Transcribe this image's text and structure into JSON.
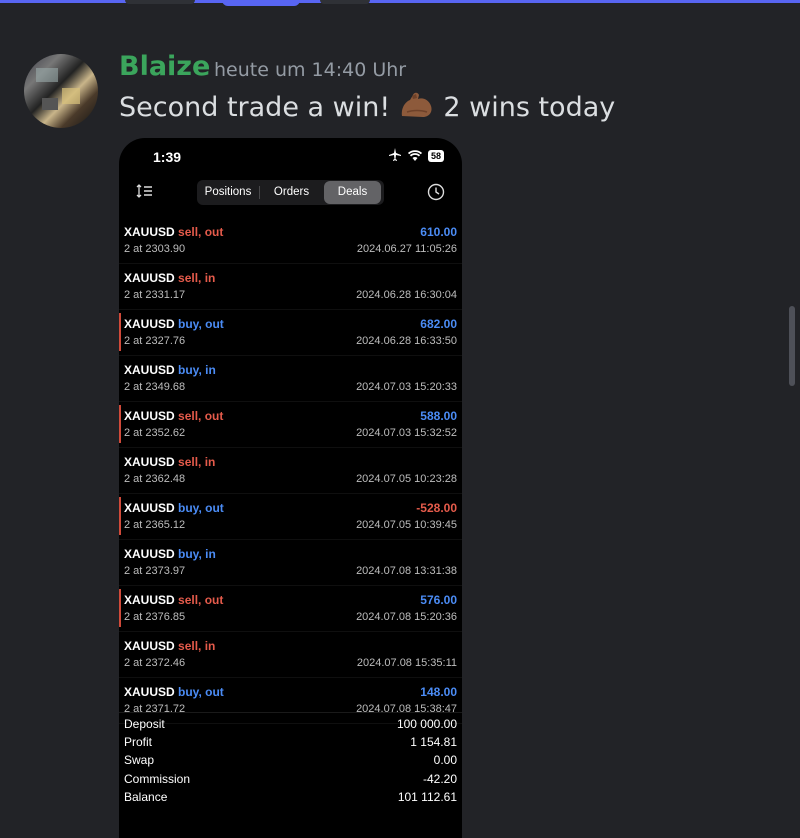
{
  "message": {
    "username": "Blaize",
    "timestamp": "heute um 14:40 Uhr",
    "text_before": "Second trade a win!",
    "emoji": "flexed-biceps-emoji",
    "text_after": "2 wins today"
  },
  "phone": {
    "status_time": "1:39",
    "battery": "58",
    "tabs": [
      {
        "label": "Positions",
        "selected": false
      },
      {
        "label": "Orders",
        "selected": false
      },
      {
        "label": "Deals",
        "selected": true
      }
    ],
    "deals": [
      {
        "symbol": "XAUUSD",
        "action": "sell, out",
        "side": "sell",
        "qty": "2 at 2303.90",
        "profit": "610.00",
        "datetime": "2024.06.27 11:05:26",
        "marked": false
      },
      {
        "symbol": "XAUUSD",
        "action": "sell, in",
        "side": "sell",
        "qty": "2 at 2331.17",
        "profit": "",
        "datetime": "2024.06.28 16:30:04",
        "marked": false
      },
      {
        "symbol": "XAUUSD",
        "action": "buy, out",
        "side": "buy",
        "qty": "2 at 2327.76",
        "profit": "682.00",
        "datetime": "2024.06.28 16:33:50",
        "marked": true
      },
      {
        "symbol": "XAUUSD",
        "action": "buy, in",
        "side": "buy",
        "qty": "2 at 2349.68",
        "profit": "",
        "datetime": "2024.07.03 15:20:33",
        "marked": false
      },
      {
        "symbol": "XAUUSD",
        "action": "sell, out",
        "side": "sell",
        "qty": "2 at 2352.62",
        "profit": "588.00",
        "datetime": "2024.07.03 15:32:52",
        "marked": true
      },
      {
        "symbol": "XAUUSD",
        "action": "sell, in",
        "side": "sell",
        "qty": "2 at 2362.48",
        "profit": "",
        "datetime": "2024.07.05 10:23:28",
        "marked": false
      },
      {
        "symbol": "XAUUSD",
        "action": "buy, out",
        "side": "buy",
        "qty": "2 at 2365.12",
        "profit": "-528.00",
        "datetime": "2024.07.05 10:39:45",
        "marked": true
      },
      {
        "symbol": "XAUUSD",
        "action": "buy, in",
        "side": "buy",
        "qty": "2 at 2373.97",
        "profit": "",
        "datetime": "2024.07.08 13:31:38",
        "marked": false
      },
      {
        "symbol": "XAUUSD",
        "action": "sell, out",
        "side": "sell",
        "qty": "2 at 2376.85",
        "profit": "576.00",
        "datetime": "2024.07.08 15:20:36",
        "marked": true
      },
      {
        "symbol": "XAUUSD",
        "action": "sell, in",
        "side": "sell",
        "qty": "2 at 2372.46",
        "profit": "",
        "datetime": "2024.07.08 15:35:11",
        "marked": false
      },
      {
        "symbol": "XAUUSD",
        "action": "buy, out",
        "side": "buy",
        "qty": "2 at 2371.72",
        "profit": "148.00",
        "datetime": "2024.07.08 15:38:47",
        "marked": false
      }
    ],
    "summary": [
      {
        "label": "Deposit",
        "value": "100 000.00"
      },
      {
        "label": "Profit",
        "value": "1 154.81"
      },
      {
        "label": "Swap",
        "value": "0.00"
      },
      {
        "label": "Commission",
        "value": "-42.20"
      },
      {
        "label": "Balance",
        "value": "101 112.61"
      }
    ]
  },
  "colors": {
    "accent": "#5865f2",
    "username": "#3ba55c",
    "sell": "#e55b4b",
    "buy": "#4b8cf5"
  }
}
